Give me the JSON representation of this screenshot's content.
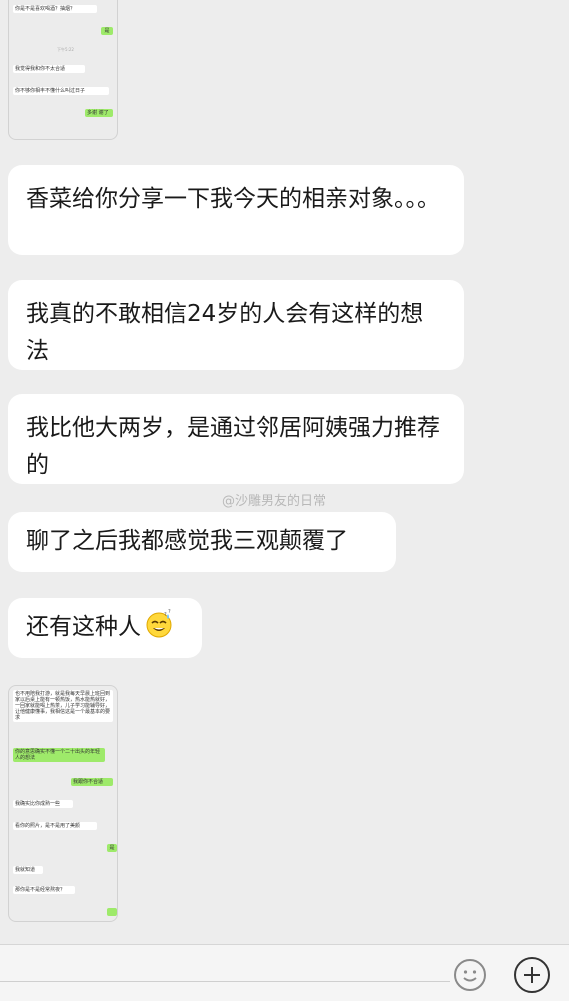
{
  "thumb1": {
    "items": [
      {
        "text": "你是不是喜欢喝酒？抽烟？",
        "side": "left"
      },
      {
        "text": "是",
        "side": "right"
      },
      {
        "text": "下午5:22",
        "side": "time"
      },
      {
        "text": "我觉得我和你不太合适",
        "side": "left"
      },
      {
        "text": "你不够你相丰不懂什么叫过日子",
        "side": "left"
      },
      {
        "text": "多谢 谢了",
        "side": "right"
      }
    ]
  },
  "messages": [
    {
      "text": "香菜给你分享一下我今天的相亲对象。。。"
    },
    {
      "text": "我真的不敢相信24岁的人会有这样的想法"
    },
    {
      "text": "我比他大两岁，是通过邻居阿姨强力推荐的"
    },
    {
      "text": "聊了之后我都感觉我三观颠覆了"
    },
    {
      "text": "还有这种人",
      "emoji": "sweat-smile-emoji"
    }
  ],
  "watermark": "@沙雕男友的日常",
  "thumb2": {
    "items": [
      {
        "text": "也不用陪我打游，就是我每天早晨上班回到家以后桌上能有一顿热饭，热水能热就好，一回家就能喝上热茶，儿子学习能辅导好，让他健康懂事，我相信这是一个最基本的要求",
        "side": "left"
      },
      {
        "text": "你的意思确实不懂一个二十出头的年轻人的想法",
        "side": "left-green"
      },
      {
        "text": "我跟你不合适",
        "side": "right"
      },
      {
        "text": "我确实比你成熟一些",
        "side": "left"
      },
      {
        "text": "看你的照片，是不是用了美颜",
        "side": "left"
      },
      {
        "text": "是",
        "side": "right"
      },
      {
        "text": "我就知道",
        "side": "left"
      },
      {
        "text": "那你是不是经常熬夜？",
        "side": "left"
      }
    ]
  },
  "inputbar": {
    "value": "",
    "emoji_icon": "smiley-face-icon",
    "plus_icon": "plus-icon"
  }
}
